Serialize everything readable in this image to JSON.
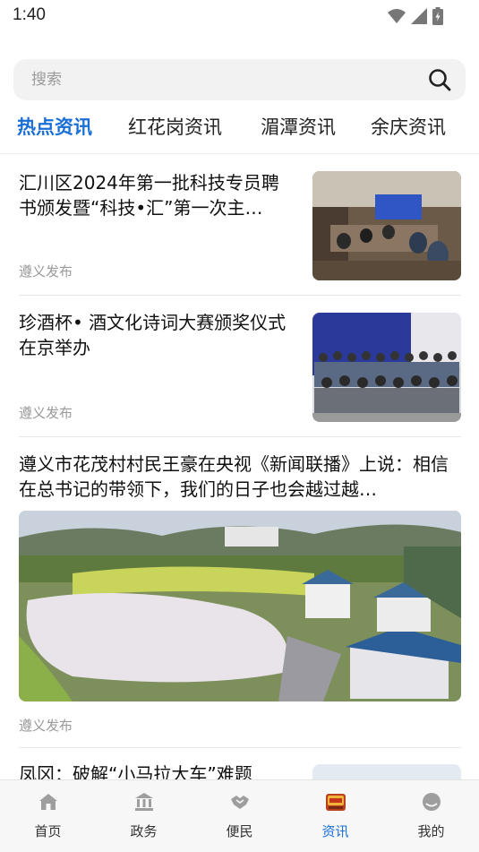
{
  "status_bar": {
    "time": "1:40"
  },
  "search": {
    "placeholder": "搜索"
  },
  "tabs": [
    {
      "label": "热点资讯",
      "active": true
    },
    {
      "label": "红花岗资讯",
      "active": false
    },
    {
      "label": "湄潭资讯",
      "active": false
    },
    {
      "label": "余庆资讯",
      "active": false
    }
  ],
  "news": [
    {
      "title": "汇川区2024年第一批科技专员聘书颁发暨“科技•汇”第一次主…",
      "source": "遵义发布"
    },
    {
      "title": "珍酒杯• 酒文化诗词大赛颁奖仪式在京举办",
      "source": "遵义发布"
    },
    {
      "title": "遵义市花茂村村民王豪在央视《新闻联播》上说：相信在总书记的带领下，我们的日子也会越过越…",
      "source": "遵义发布"
    },
    {
      "title": "凤冈：破解“小马拉大车”难题"
    }
  ],
  "bottom_nav": [
    {
      "label": "首页",
      "icon": "home-icon",
      "active": false
    },
    {
      "label": "政务",
      "icon": "government-building-icon",
      "active": false
    },
    {
      "label": "便民",
      "icon": "handshake-icon",
      "active": false
    },
    {
      "label": "资讯",
      "icon": "news-badge-icon",
      "active": true
    },
    {
      "label": "我的",
      "icon": "profile-icon",
      "active": false
    }
  ],
  "colors": {
    "accent": "#1a6fd6",
    "text": "#111111",
    "muted": "#9a9a9a"
  }
}
